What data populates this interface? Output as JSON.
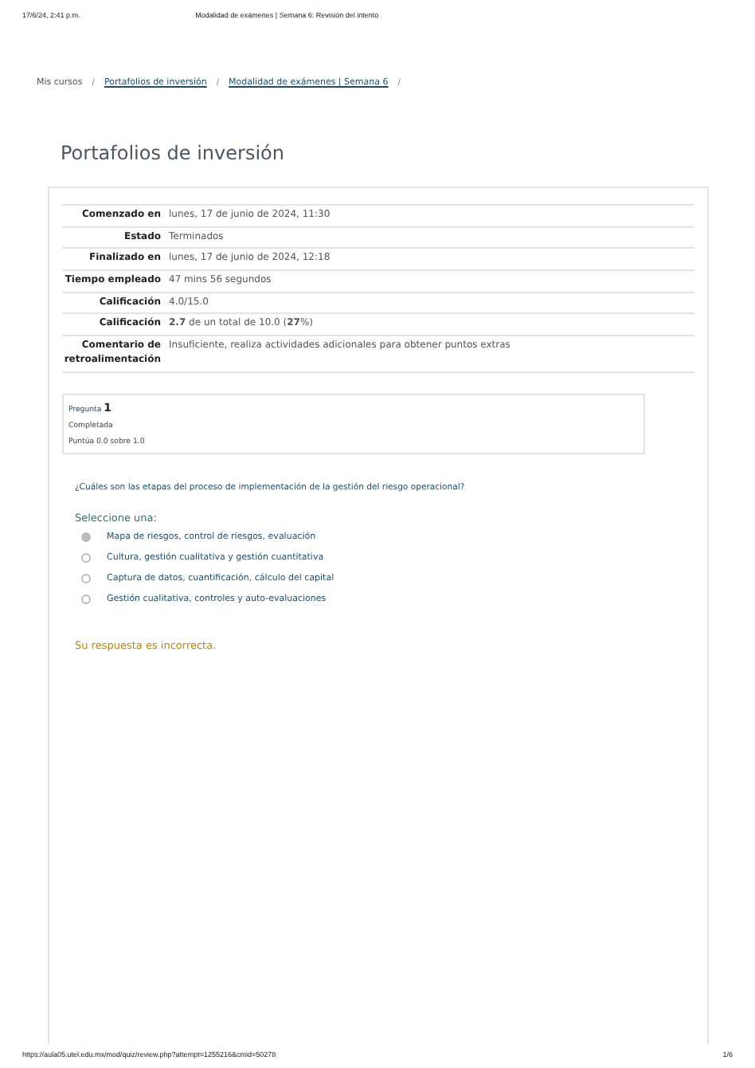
{
  "print_header": {
    "date": "17/6/24, 2:41 p.m.",
    "title": "Modalidad de exámenes | Semana 6: Revisión del intento"
  },
  "breadcrumb": [
    "Mis cursos",
    "Portafolios de inversión",
    "Modalidad de exámenes | Semana 6"
  ],
  "breadcrumb_separator": "/",
  "page_title": "Portafolios de inversión",
  "summary": [
    {
      "label": "Comenzado en",
      "value": "lunes, 17 de junio de 2024, 11:30"
    },
    {
      "label": "Estado",
      "value": "Terminados"
    },
    {
      "label": "Finalizado en",
      "value": "lunes, 17 de junio de 2024, 12:18"
    },
    {
      "label": "Tiempo empleado",
      "value": "47 mins 56 segundos"
    },
    {
      "label": "Calificación",
      "value": "4.0/15.0"
    },
    {
      "label": "Calificación",
      "value": "**2.7** de un total de 10.0 (**27**%)"
    },
    {
      "label": "Comentario de retroalimentación",
      "value": "Insuficiente, realiza actividades adicionales para obtener puntos extras"
    }
  ],
  "question_info": {
    "label": "Pregunta",
    "number": "1",
    "state": "Completada",
    "grade": "Puntúa 0.0 sobre 1.0"
  },
  "question": {
    "text": "¿Cuáles son las etapas del proceso de implementación de la gestión del riesgo operacional?",
    "prompt": "Seleccione una:",
    "options": [
      {
        "label": "Mapa de riesgos, control de riesgos, evaluación",
        "selected": true
      },
      {
        "label": "Cultura, gestión cualitativa y gestión cuantitativa",
        "selected": false
      },
      {
        "label": "Captura de datos, cuantificación, cálculo del capital",
        "selected": false
      },
      {
        "label": "Gestión cualitativa, controles y auto-evaluaciones",
        "selected": false
      }
    ],
    "feedback": "Su respuesta es incorrecta."
  },
  "print_footer": {
    "url": "https://aula05.utel.edu.mx/mod/quiz/review.php?attempt=1255216&cmid=50278",
    "page": "1/6"
  }
}
